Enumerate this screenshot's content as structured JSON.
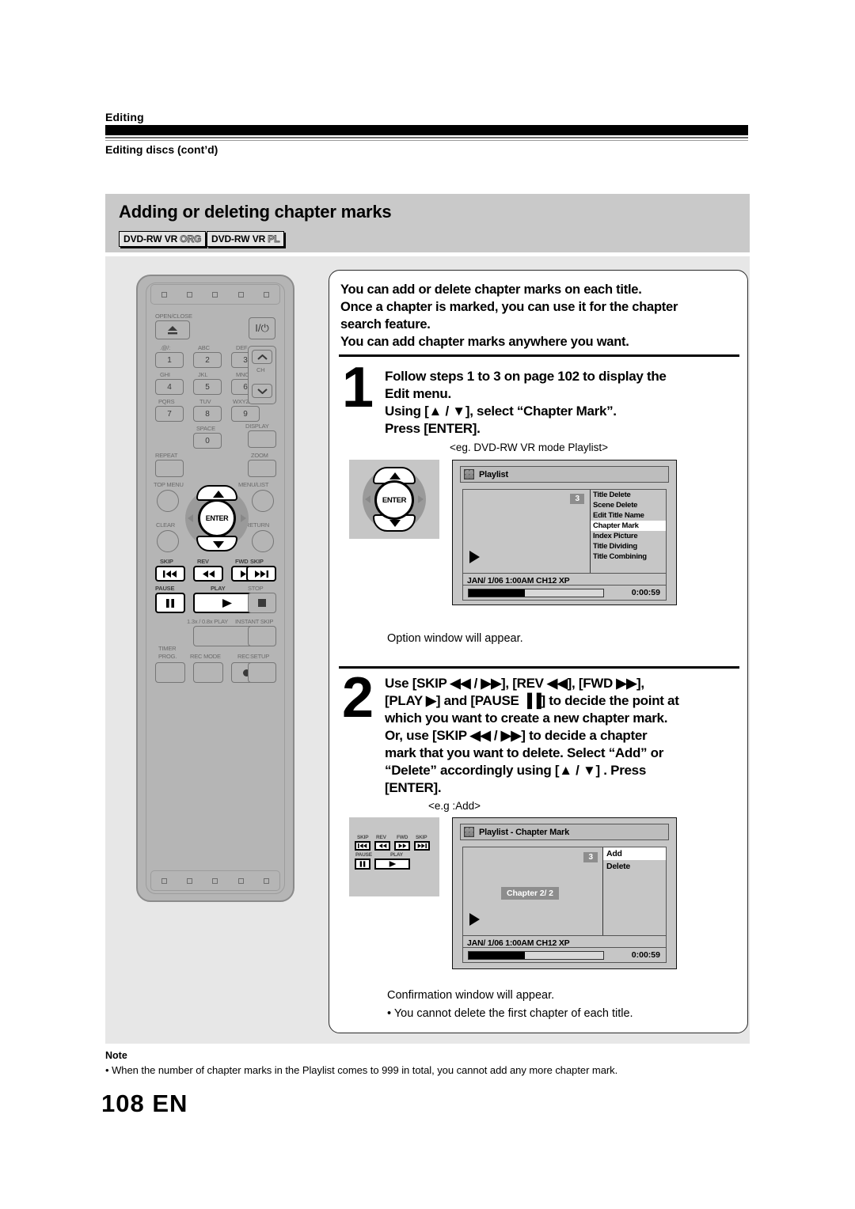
{
  "header": {
    "section": "Editing",
    "subsection": "Editing discs (cont’d)"
  },
  "title_band": {
    "title": "Adding or deleting chapter marks",
    "badges": [
      {
        "main": "DVD-RW VR",
        "mode": "ORG"
      },
      {
        "main": "DVD-RW VR",
        "mode": "PL"
      }
    ]
  },
  "intro": [
    "You can add or delete chapter marks on each title.",
    "Once a chapter is marked, you can use it for the chapter",
    "search feature.",
    "You can add chapter marks anywhere you want."
  ],
  "steps": [
    {
      "number": "1",
      "lines": [
        "Follow steps 1 to 3 on page 102 to display the",
        "Edit menu.",
        "Using [▲ / ▼], select “Chapter Mark”.",
        "Press [ENTER]."
      ],
      "eg_caption": "<eg. DVD-RW VR mode Playlist>",
      "result": "Option window will appear."
    },
    {
      "number": "2",
      "lines": [
        "Use [SKIP ◀◀ / ▶▶], [REV ◀◀], [FWD ▶▶],",
        "[PLAY ▶] and [PAUSE ▐▐]  to decide the point at",
        "which you want to create a new chapter mark.",
        "Or, use [SKIP ◀◀ / ▶▶] to decide a chapter",
        "mark that you want to delete. Select “Add” or",
        "“Delete” accordingly using [▲ / ▼] . Press",
        "[ENTER]."
      ],
      "eg_caption": "<e.g :Add>",
      "result": "Confirmation window will appear.",
      "result_note": "• You cannot delete the first chapter of each title."
    }
  ],
  "screens": [
    {
      "title": "Playlist",
      "icon": "vr-mode-icon",
      "title_number": "3",
      "menu_items": [
        {
          "label": "Title Delete",
          "selected": false
        },
        {
          "label": "Scene Delete",
          "selected": false
        },
        {
          "label": "Edit Title Name",
          "selected": false
        },
        {
          "label": "Chapter Mark",
          "selected": true
        },
        {
          "label": "Index Picture",
          "selected": false
        },
        {
          "label": "Title Dividing",
          "selected": false
        },
        {
          "label": "Title Combining",
          "selected": false
        }
      ],
      "info": "JAN/ 1/06 1:00AM CH12 XP",
      "time": "0:00:59",
      "progress_percent": 42
    },
    {
      "title": "Playlist - Chapter Mark",
      "icon": "vr-mode-icon",
      "title_number": "3",
      "chapter_chip": "Chapter    2/  2",
      "menu_items": [
        {
          "label": "Add",
          "selected": true
        },
        {
          "label": "Delete",
          "selected": false
        }
      ],
      "info": "JAN/ 1/06 1:00AM CH12 XP",
      "time": "0:00:59",
      "progress_percent": 42
    }
  ],
  "remote": {
    "open_close": "OPEN/CLOSE",
    "power": "I/⏻",
    "numeric": [
      {
        "top": ".@/:",
        "key": "1"
      },
      {
        "top": "ABC",
        "key": "2"
      },
      {
        "top": "DEF",
        "key": "3"
      },
      {
        "top": "GHI",
        "key": "4"
      },
      {
        "top": "JKL",
        "key": "5"
      },
      {
        "top": "MNO",
        "key": "6"
      },
      {
        "top": "PQRS",
        "key": "7"
      },
      {
        "top": "TUV",
        "key": "8"
      },
      {
        "top": "WXYZ",
        "key": "9"
      },
      {
        "top": "SPACE",
        "key": "0"
      }
    ],
    "ch_label": "CH",
    "display": "DISPLAY",
    "repeat": "REPEAT",
    "zoom": "ZOOM",
    "top_menu": "TOP MENU",
    "menu_list": "MENU/LIST",
    "clear": "CLEAR",
    "return": "RETURN",
    "enter": "ENTER",
    "transport": {
      "skip_back": "SKIP",
      "rev": "REV",
      "fwd": "FWD",
      "skip_fwd": "SKIP",
      "pause": "PAUSE",
      "play": "PLAY",
      "stop": "STOP"
    },
    "speed_play": "1.3x / 0.8x PLAY",
    "instant_skip": "INSTANT SKIP",
    "timer_prog_line1": "TIMER",
    "timer_prog_line2": "PROG.",
    "rec_mode": "REC MODE",
    "rec": "REC",
    "setup": "SETUP"
  },
  "mini_diagram_2": {
    "skip_back": "SKIP",
    "rev": "REV",
    "fwd": "FWD",
    "skip_fwd": "SKIP",
    "pause": "PAUSE",
    "play": "PLAY"
  },
  "footer": {
    "note_title": "Note",
    "note_text": "• When the number of chapter marks in the Playlist comes to 999 in total, you cannot add any more chapter mark.",
    "page": "108  EN"
  }
}
